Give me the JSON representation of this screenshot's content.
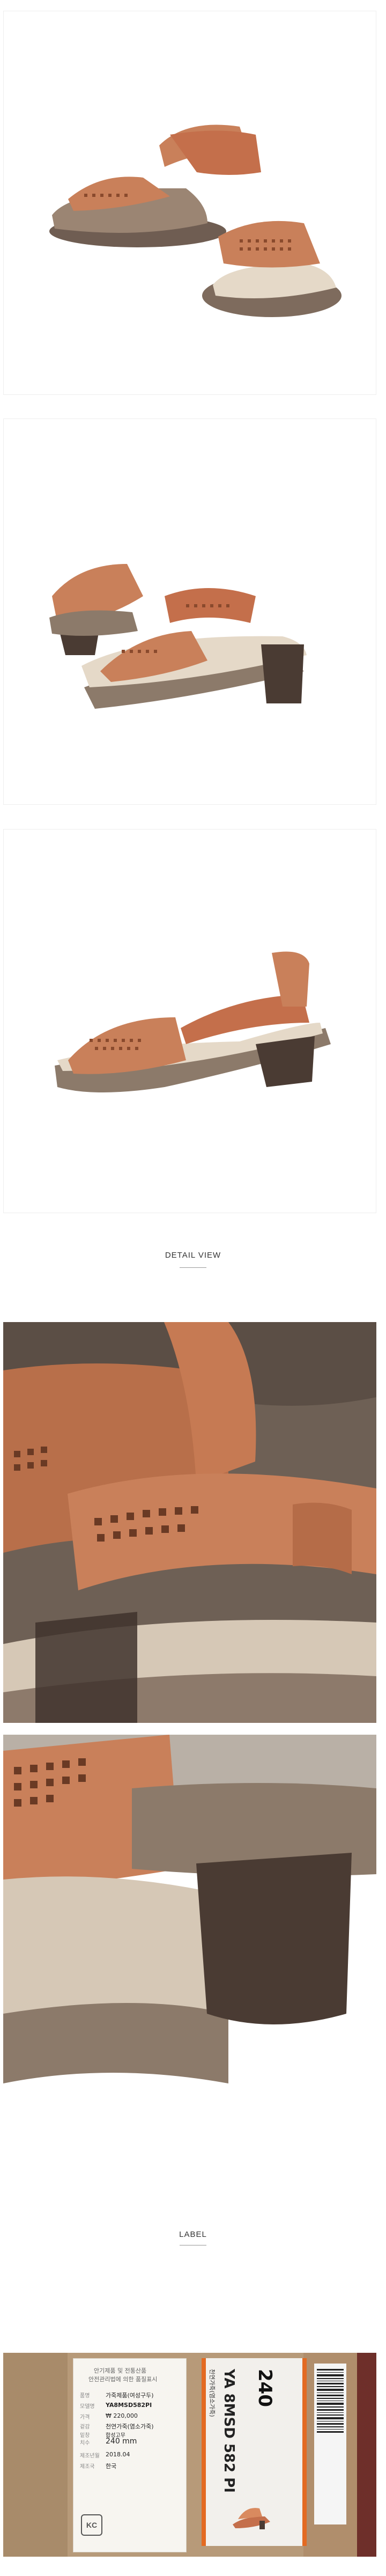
{
  "sections": {
    "detail_title": "DETAIL VIEW",
    "label_title": "LABEL"
  },
  "label": {
    "header_line1": "안기제품 및 전통산품",
    "header_line2": "안전관리법에 의한 품질표시",
    "rows": [
      {
        "key": "품명",
        "value": "가죽제품(여성구두)"
      },
      {
        "key": "모델명",
        "value": "YA8MSD582PI"
      },
      {
        "key": "겉감",
        "value": "천연가죽(염소가죽)"
      },
      {
        "key": "치수",
        "value": "240 mm"
      },
      {
        "key": "제조년월",
        "value": "2018.04"
      },
      {
        "key": "제조국",
        "value": "한국"
      },
      {
        "key": "밑창",
        "value": "합성고무"
      },
      {
        "key": "가격",
        "value": "₩ 220,000"
      }
    ],
    "tag_size": "240",
    "tag_model": "YA 8MSD 582 PI",
    "tag_sub": "천연가죽(염소가죽)"
  },
  "colors": {
    "leather": "#c9805a",
    "cork": "#8c7a6a",
    "heel": "#4a3b33",
    "label_bg": "#b79a79"
  }
}
